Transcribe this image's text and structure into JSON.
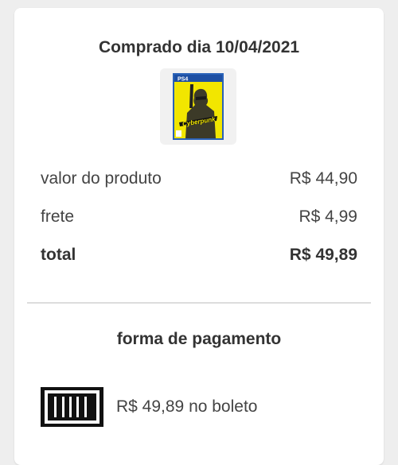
{
  "order": {
    "title": "Comprado dia 10/04/2021",
    "product_image": "cyberpunk-2077-ps4-cover"
  },
  "summary": {
    "rows": [
      {
        "label": "valor do produto",
        "value": "R$ 44,90"
      },
      {
        "label": "frete",
        "value": "R$ 4,99"
      },
      {
        "label": "total",
        "value": "R$ 49,89"
      }
    ]
  },
  "payment": {
    "title": "forma de pagamento",
    "icon": "barcode-icon",
    "text": "R$ 49,89 no boleto"
  },
  "colors": {
    "card": "#ffffff",
    "background": "#eeeeee",
    "text": "#333333",
    "divider": "#dcdcdc"
  }
}
